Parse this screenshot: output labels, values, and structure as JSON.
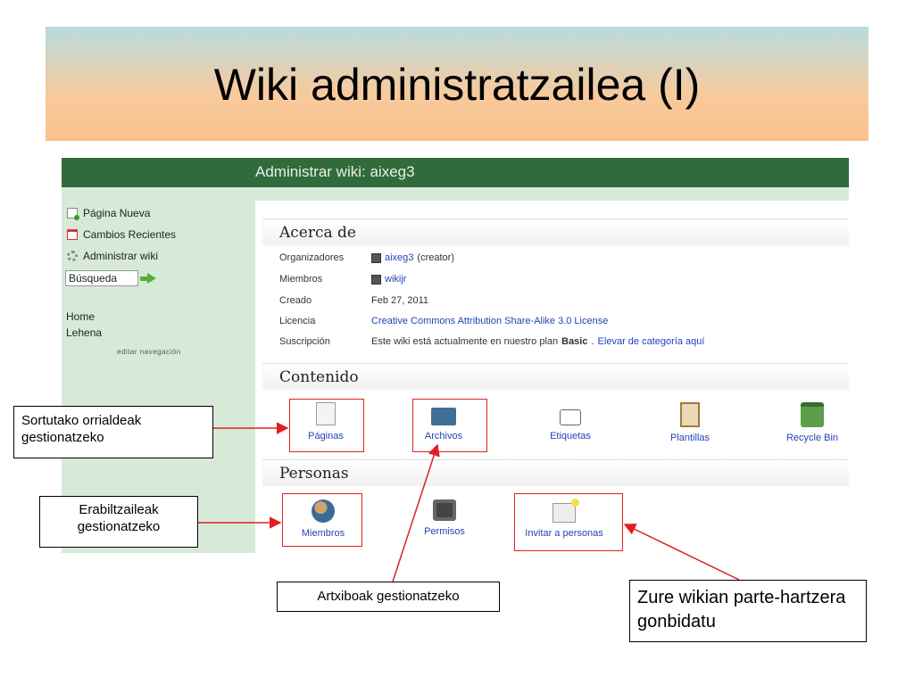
{
  "slide": {
    "title": "Wiki administratzailea (I)"
  },
  "header": {
    "title": "Administrar wiki: aixeg3"
  },
  "sidebar": {
    "items": [
      {
        "label": "Página Nueva",
        "icon": "new-page-icon"
      },
      {
        "label": "Cambios Recientes",
        "icon": "calendar-icon"
      },
      {
        "label": "Administrar wiki",
        "icon": "gear-icon"
      }
    ],
    "search_value": "Búsqueda",
    "nav_links": [
      "Home",
      "Lehena"
    ],
    "edit_nav": "editar navegación"
  },
  "about": {
    "title": "Acerca de",
    "organizers_label": "Organizadores",
    "organizers_user": "aixeg3",
    "organizers_note": "(creator)",
    "members_label": "Miembros",
    "members_user": "wikijr",
    "created_label": "Creado",
    "created_value": "Feb 27, 2011",
    "license_label": "Licencia",
    "license_value": "Creative Commons Attribution Share-Alike 3.0 License",
    "subscription_label": "Suscripción",
    "subscription_text": "Este wiki está actualmente en nuestro plan",
    "subscription_plan": "Basic",
    "subscription_sep": ".",
    "subscription_link": "Elevar de categoría aquí"
  },
  "content": {
    "title": "Contenido",
    "tiles": [
      "Páginas",
      "Archivos",
      "Etiquetas",
      "Plantillas",
      "Recycle Bin"
    ]
  },
  "people": {
    "title": "Personas",
    "tiles": [
      "Miembros",
      "Permisos",
      "Invitar a personas"
    ]
  },
  "callouts": {
    "pages": "Sortutako orrialdeak gestionatzeko",
    "users": "Erabiltzaileak gestionatzeko",
    "files": "Artxiboak gestionatzeko",
    "invite": "Zure wikian parte-hartzera gonbidatu"
  },
  "colors": {
    "topbar": "#316b3c",
    "sidebar": "#d7ead7",
    "link": "#2243b5",
    "highlight": "#e02020"
  }
}
